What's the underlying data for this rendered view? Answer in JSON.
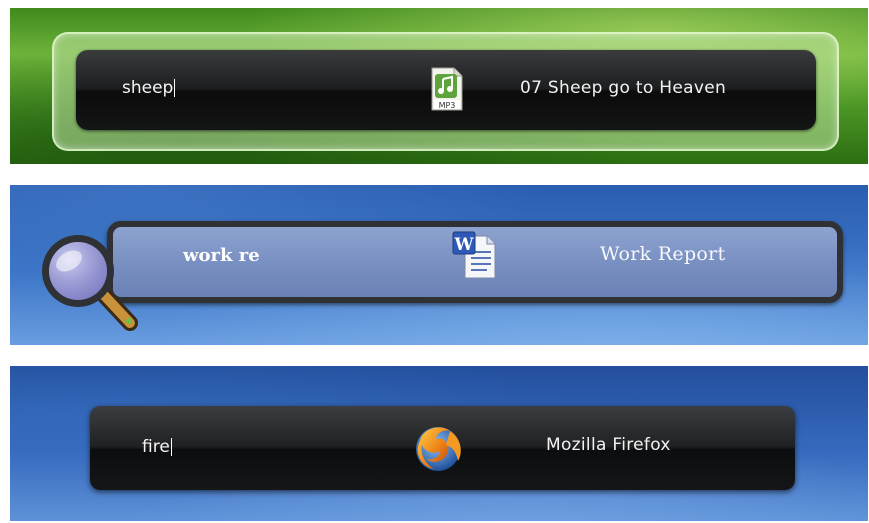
{
  "panels": [
    {
      "query": "sheep",
      "result": "07 Sheep go to Heaven",
      "file_icon": "mp3-file-icon",
      "badge": "MP3"
    },
    {
      "query": "work re",
      "result": "Work Report",
      "file_icon": "word-document-icon"
    },
    {
      "query": "fire",
      "result": "Mozilla Firefox",
      "file_icon": "firefox-icon"
    }
  ],
  "colors": {
    "green_bg": "#4f9a28",
    "blue_bg": "#3669bd",
    "dark_bar": "#1d1e1f",
    "light_bar": "#7990c2"
  }
}
